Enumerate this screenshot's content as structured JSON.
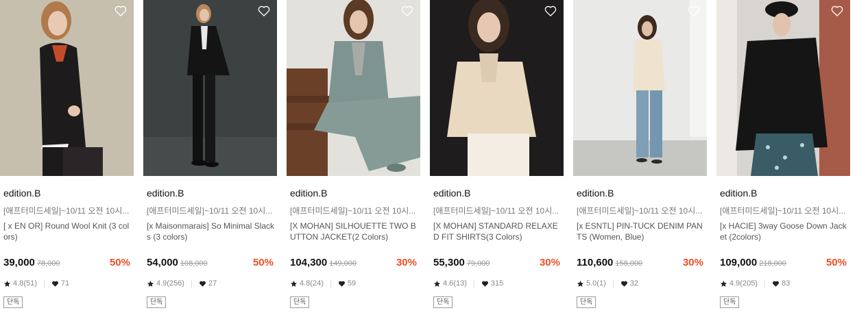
{
  "colors": {
    "discount": "#f04e23",
    "text": "#111111",
    "muted": "#888888"
  },
  "products": [
    {
      "brand": "edition.B",
      "promo": "[애프터미드세일]~10/11 오전 10시...",
      "name": "[ x EN OR] Round Wool Knit (3 colors)",
      "price": "39,000",
      "original_price": "78,000",
      "discount": "50%",
      "rating": "4.8(51)",
      "likes": "71",
      "badge": "단독",
      "icons": [
        "heart-outline-icon",
        "star-icon",
        "heart-icon"
      ]
    },
    {
      "brand": "edition.B",
      "promo": "[애프터미드세일]~10/11 오전 10시...",
      "name": "[x Maisonmarais] So Minimal Slacks (3 colors)",
      "price": "54,000",
      "original_price": "108,000",
      "discount": "50%",
      "rating": "4.9(256)",
      "likes": "27",
      "badge": "단독",
      "icons": [
        "heart-outline-icon",
        "star-icon",
        "heart-icon"
      ]
    },
    {
      "brand": "edition.B",
      "promo": "[애프터미드세일]~10/11 오전 10시...",
      "name": "[X MOHAN] SILHOUETTE TWO BUTTON JACKET(2 Colors)",
      "price": "104,300",
      "original_price": "149,000",
      "discount": "30%",
      "rating": "4.8(24)",
      "likes": "59",
      "badge": "단독",
      "icons": [
        "heart-outline-icon",
        "star-icon",
        "heart-icon"
      ]
    },
    {
      "brand": "edition.B",
      "promo": "[애프터미드세일]~10/11 오전 10시...",
      "name": "[X MOHAN] STANDARD RELAXED FIT SHIRTS(3 Colors)",
      "price": "55,300",
      "original_price": "79,000",
      "discount": "30%",
      "rating": "4.6(13)",
      "likes": "315",
      "badge": "단독",
      "icons": [
        "heart-outline-icon",
        "star-icon",
        "heart-icon"
      ]
    },
    {
      "brand": "edition.B",
      "promo": "[애프터미드세일]~10/11 오전 10시...",
      "name": "[x ESNTL] PIN-TUCK DENIM PANTS (Women, Blue)",
      "price": "110,600",
      "original_price": "158,000",
      "discount": "30%",
      "rating": "5.0(1)",
      "likes": "32",
      "badge": "단독",
      "icons": [
        "heart-outline-icon",
        "star-icon",
        "heart-icon"
      ]
    },
    {
      "brand": "edition.B",
      "promo": "[애프터미드세일]~10/11 오전 10시...",
      "name": "[x HACIE] 3way Goose Down Jacket (2colors)",
      "price": "109,000",
      "original_price": "218,000",
      "discount": "50%",
      "rating": "4.9(205)",
      "likes": "83",
      "badge": "단독",
      "icons": [
        "heart-outline-icon",
        "star-icon",
        "heart-icon"
      ]
    }
  ]
}
